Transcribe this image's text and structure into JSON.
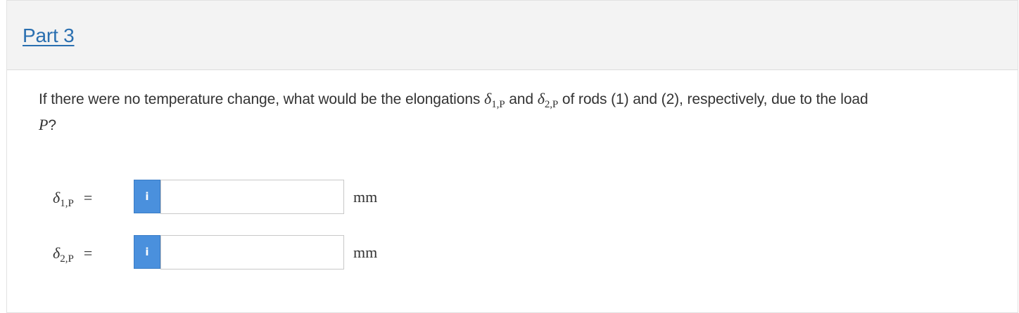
{
  "part": {
    "title": "Part 3"
  },
  "question": {
    "text_before": "If there were no temperature change, what would be the elongations ",
    "sym1": "δ",
    "sub1": "1,P",
    "text_mid": " and ",
    "sym2": "δ",
    "sub2": "2,P",
    "text_after": " of rods (1) and (2), respectively, due to the load ",
    "load": "P",
    "end": "?"
  },
  "answers": [
    {
      "symbol": "δ",
      "subscript": "1,P",
      "equals": "=",
      "info_label": "i",
      "value": "",
      "unit": "mm"
    },
    {
      "symbol": "δ",
      "subscript": "2,P",
      "equals": "=",
      "info_label": "i",
      "value": "",
      "unit": "mm"
    }
  ],
  "colors": {
    "link": "#2a6fb0",
    "info_button": "#4a90dd",
    "header_bg": "#f3f3f3"
  },
  "icons": {
    "info": "info-icon"
  }
}
